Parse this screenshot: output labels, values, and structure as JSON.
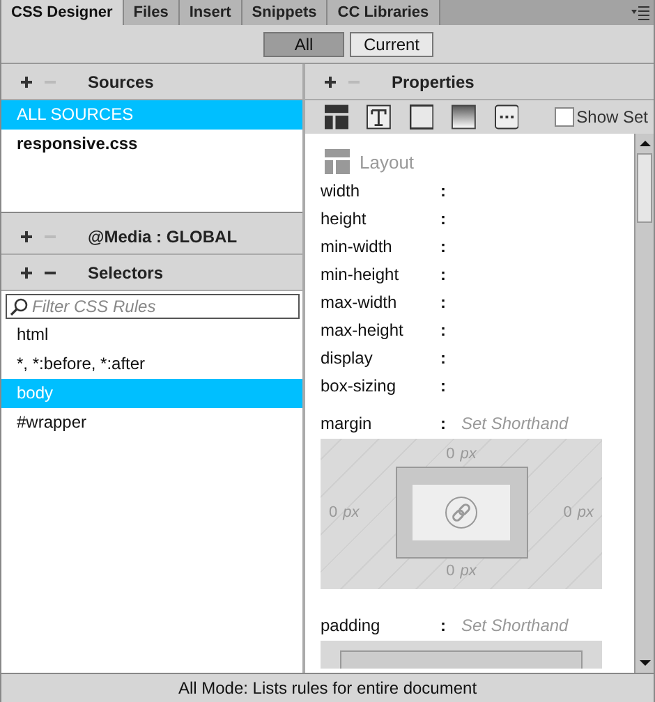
{
  "tabs": [
    {
      "label": "CSS Designer",
      "selected": true
    },
    {
      "label": "Files",
      "selected": false
    },
    {
      "label": "Insert",
      "selected": false
    },
    {
      "label": "Snippets",
      "selected": false
    },
    {
      "label": "CC Libraries",
      "selected": false
    }
  ],
  "modes": [
    {
      "label": "All",
      "selected": true
    },
    {
      "label": "Current",
      "selected": false
    }
  ],
  "sources": {
    "title": "Sources",
    "items": [
      {
        "label": "ALL SOURCES",
        "selected": true,
        "bold": false
      },
      {
        "label": "responsive.css",
        "selected": false,
        "bold": true
      }
    ]
  },
  "media": {
    "title": "@Media :  GLOBAL"
  },
  "selectors": {
    "title": "Selectors",
    "filter_placeholder": "Filter CSS Rules",
    "items": [
      {
        "label": "html",
        "selected": false
      },
      {
        "label": "*, *:before, *:after",
        "selected": false
      },
      {
        "label": "body",
        "selected": true
      },
      {
        "label": "#wrapper",
        "selected": false
      }
    ]
  },
  "properties": {
    "title": "Properties",
    "show_set": {
      "label": "Show Set",
      "checked": false
    },
    "categories": [
      {
        "kind": "layout"
      },
      {
        "kind": "text"
      },
      {
        "kind": "border"
      },
      {
        "kind": "background"
      },
      {
        "kind": "more"
      }
    ],
    "section": "Layout",
    "fields": [
      {
        "name": "width",
        "separator": ":"
      },
      {
        "name": "height",
        "separator": ":"
      },
      {
        "name": "min-width",
        "separator": ":"
      },
      {
        "name": "min-height",
        "separator": ":"
      },
      {
        "name": "max-width",
        "separator": ":"
      },
      {
        "name": "max-height",
        "separator": ":"
      },
      {
        "name": "display",
        "separator": ":"
      },
      {
        "name": "box-sizing",
        "separator": ":"
      }
    ],
    "margin": {
      "name": "margin",
      "separator": ":",
      "shorthand": "Set Shorthand",
      "top": {
        "value": "0",
        "unit": "px"
      },
      "right": {
        "value": "0",
        "unit": "px"
      },
      "bottom": {
        "value": "0",
        "unit": "px"
      },
      "left": {
        "value": "0",
        "unit": "px"
      }
    },
    "padding": {
      "name": "padding",
      "separator": ":",
      "shorthand": "Set Shorthand"
    }
  },
  "status_bar": "All Mode: Lists rules for entire document"
}
